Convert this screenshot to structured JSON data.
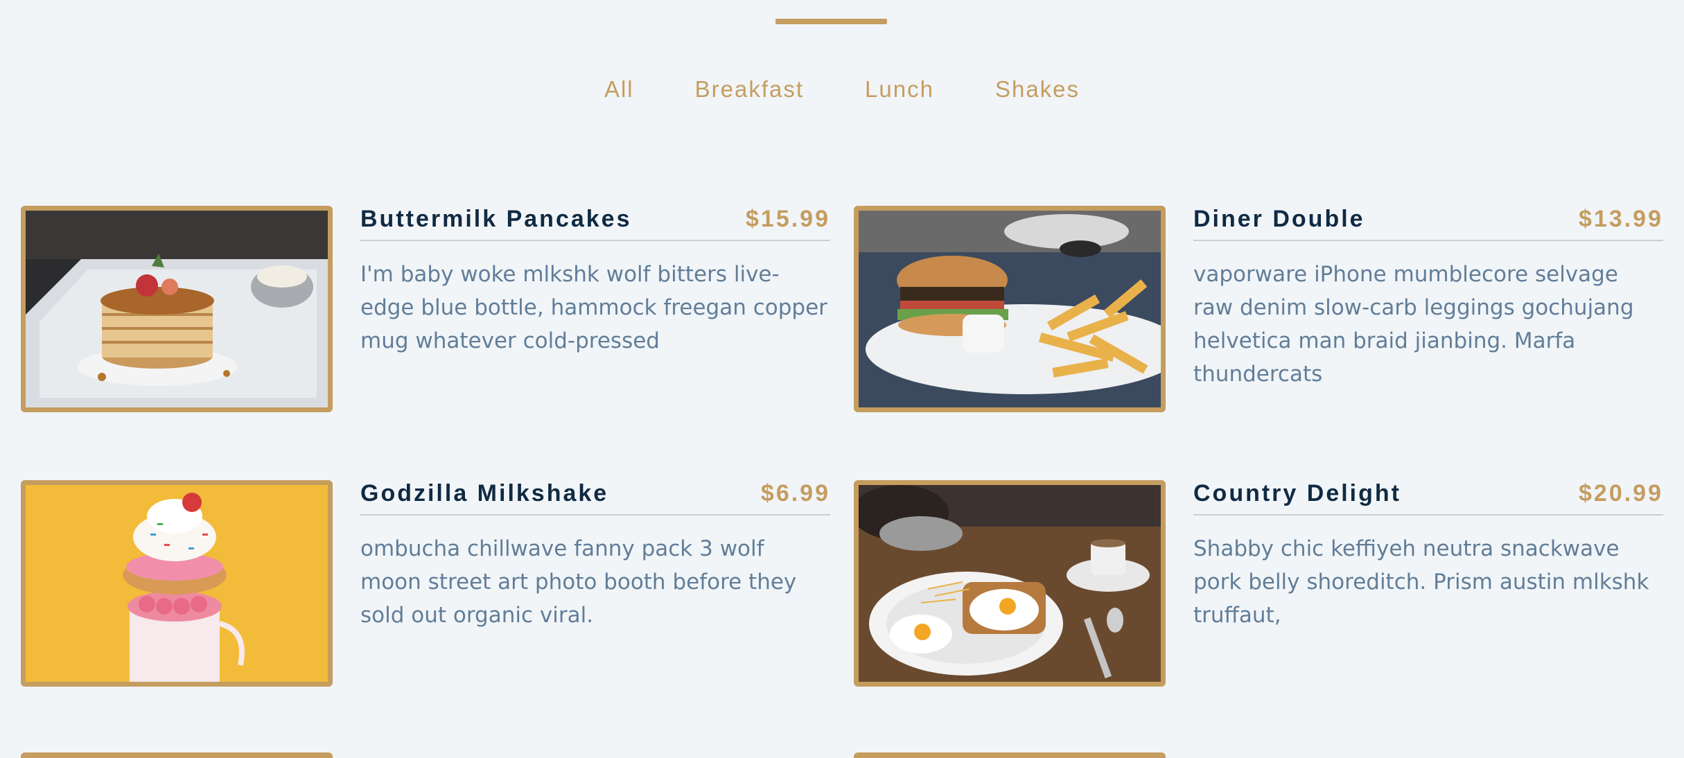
{
  "filters": [
    "All",
    "Breakfast",
    "Lunch",
    "Shakes"
  ],
  "menu": [
    {
      "title": "Buttermilk Pancakes",
      "price": "$15.99",
      "desc": "I'm baby woke mlkshk wolf bitters live-edge blue bottle, hammock freegan copper mug whatever cold-pressed"
    },
    {
      "title": "Diner Double",
      "price": "$13.99",
      "desc": "vaporware iPhone mumblecore selvage raw denim slow-carb leggings gochujang helvetica man braid jianbing. Marfa thundercats"
    },
    {
      "title": "Godzilla Milkshake",
      "price": "$6.99",
      "desc": "ombucha chillwave fanny pack 3 wolf moon street art photo booth before they sold out organic viral."
    },
    {
      "title": "Country Delight",
      "price": "$20.99",
      "desc": "Shabby chic keffiyeh neutra snackwave pork belly shoreditch. Prism austin mlkshk truffaut,"
    }
  ],
  "colors": {
    "accent": "#c59d5f",
    "title": "#102a42",
    "text": "#617d98",
    "background": "#f1f5f8"
  }
}
